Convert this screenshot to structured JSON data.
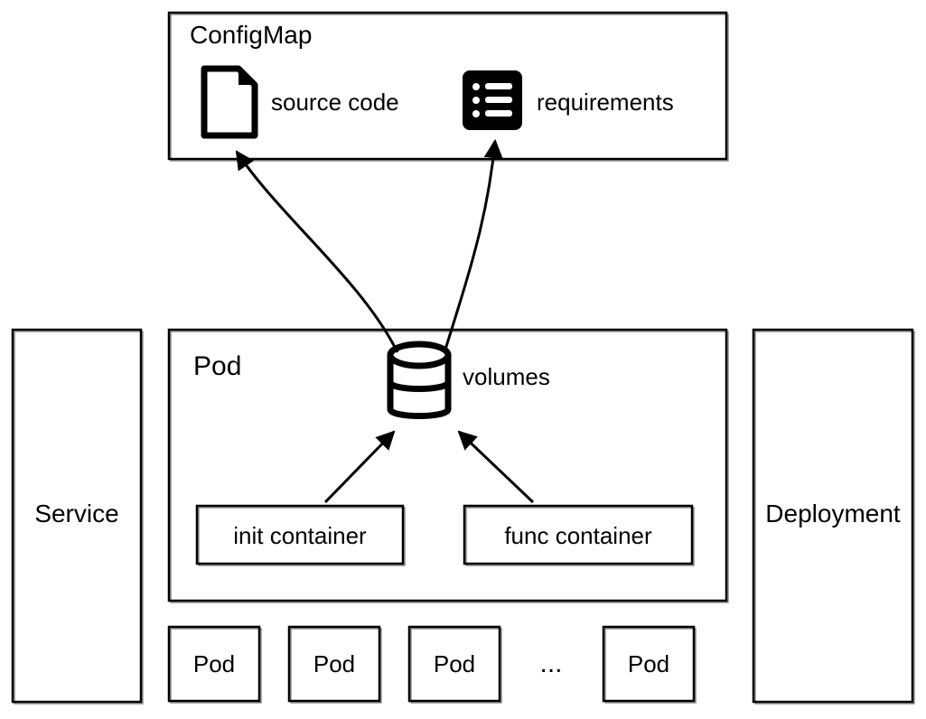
{
  "configmap": {
    "title": "ConfigMap",
    "source_code_label": "source code",
    "requirements_label": "requirements"
  },
  "pod": {
    "title": "Pod",
    "volumes_label": "volumes",
    "init_container_label": "init container",
    "func_container_label": "func container"
  },
  "service": {
    "title": "Service"
  },
  "deployment": {
    "title": "Deployment"
  },
  "pods_row": {
    "labels": [
      "Pod",
      "Pod",
      "Pod",
      "Pod"
    ],
    "ellipsis": "..."
  }
}
